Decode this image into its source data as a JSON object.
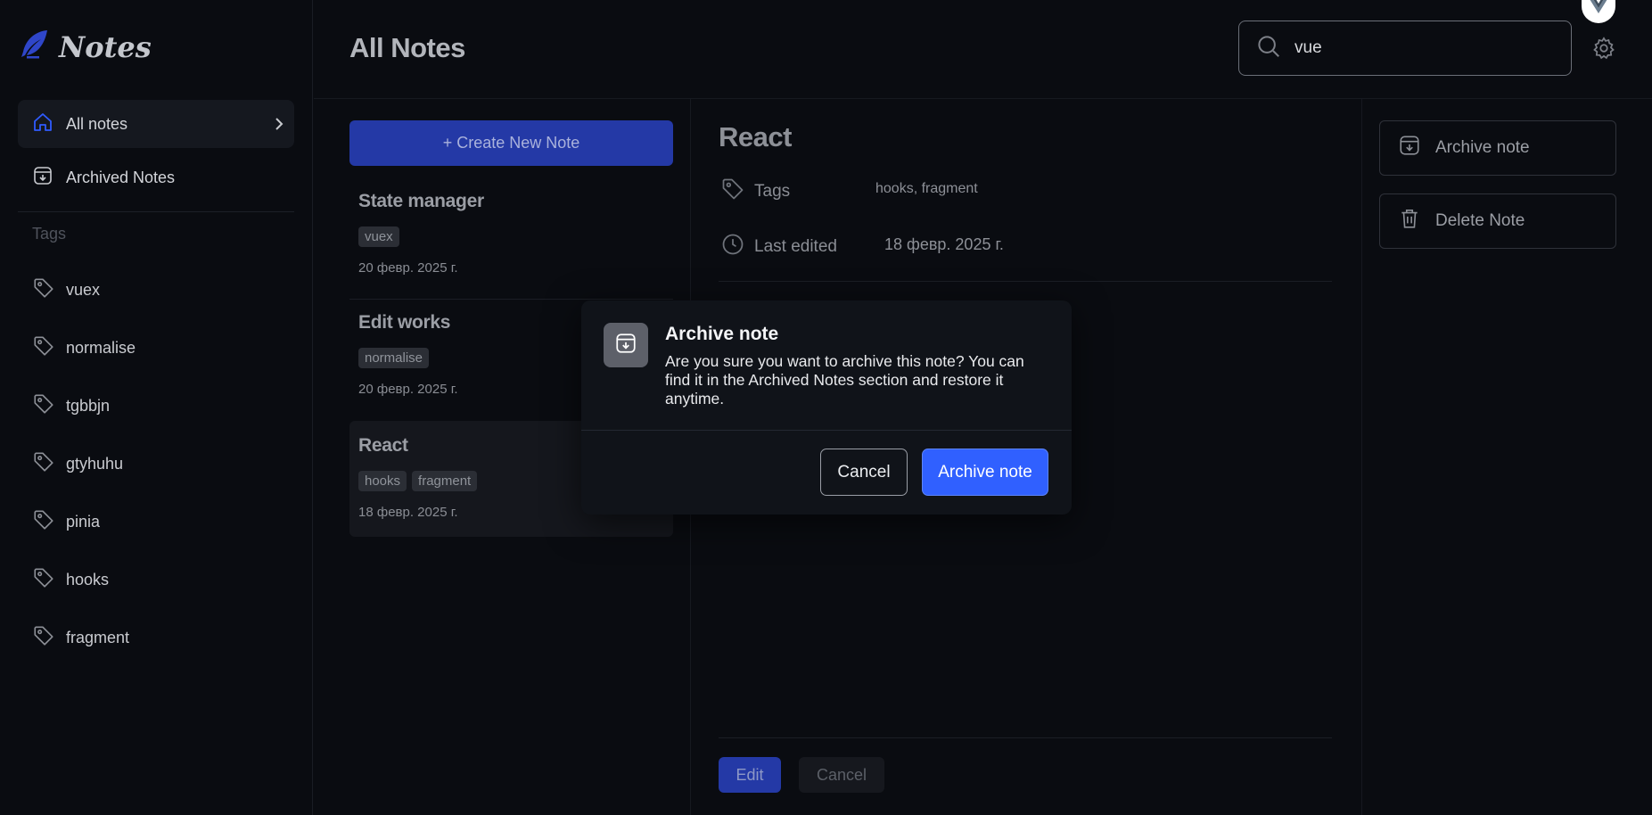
{
  "app": {
    "name": "Notes"
  },
  "sidebar": {
    "nav": [
      {
        "label": "All notes"
      },
      {
        "label": "Archived Notes"
      }
    ],
    "tags_title": "Tags",
    "tags": [
      "vuex",
      "normalise",
      "tgbbjn",
      "gtyhuhu",
      "pinia",
      "hooks",
      "fragment"
    ]
  },
  "header": {
    "title": "All Notes",
    "search_value": "vue"
  },
  "list": {
    "create_label": "+ Create New Note",
    "notes": [
      {
        "title": "State manager",
        "tags": [
          "vuex"
        ],
        "date": "20 февр. 2025 г."
      },
      {
        "title": "Edit works",
        "tags": [
          "normalise"
        ],
        "date": "20 февр. 2025 г."
      },
      {
        "title": "React",
        "tags": [
          "hooks",
          "fragment"
        ],
        "date": "18 февр. 2025 г."
      }
    ]
  },
  "detail": {
    "title": "React",
    "tags_label": "Tags",
    "tags_value": "hooks, fragment",
    "edited_label": "Last edited",
    "edited_value": "18 февр. 2025 г.",
    "edit_label": "Edit",
    "cancel_label": "Cancel"
  },
  "actions": {
    "archive_label": "Archive note",
    "delete_label": "Delete Note"
  },
  "modal": {
    "title": "Archive note",
    "text": "Are you sure you want to archive this note? You can find it in the Archived Notes section and restore it anytime.",
    "cancel_label": "Cancel",
    "confirm_label": "Archive note"
  },
  "colors": {
    "accent": "#3060ff",
    "accent_dim": "#2439a6",
    "background": "#0a0c11"
  }
}
